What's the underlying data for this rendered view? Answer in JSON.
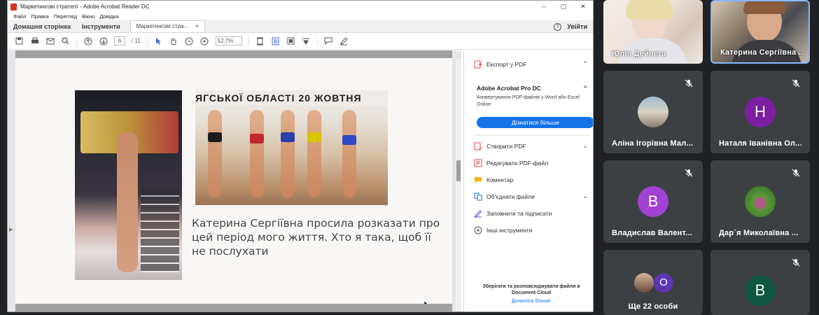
{
  "acrobat": {
    "window_title": "Маркетингові стратегії - Adobe Acrobat Reader DC",
    "window_buttons": [
      "–",
      "▢",
      "✕"
    ],
    "menu": [
      "Файл",
      "Правка",
      "Перегляд",
      "Вікно",
      "Довідка"
    ],
    "tabs": {
      "home": "Домашня сторінка",
      "tools": "Інструменти",
      "doc": "Маркетингові стра...",
      "doc_close": "×",
      "signin": "Увійти",
      "help": "?"
    },
    "toolbar": {
      "page_current": "6",
      "page_total": "/ 11",
      "zoom": "52,7%"
    },
    "document": {
      "banner_text": "ЯГСЬКОЇ ОБЛАСТІ 20 ЖОВТНЯ",
      "paragraph": "Катерина Сергіївна просила розказати про цей період мого життя. Хто я така, щоб її не послухати"
    },
    "right_panel": {
      "export_label": "Експорт у PDF",
      "promo_title": "Adobe Acrobat Pro DC",
      "promo_desc": "Конвертування PDF-файлів у Word або Excel Online",
      "promo_button": "Дізнатися більше",
      "tools": [
        {
          "label": "Створити PDF",
          "icon": "create-pdf-icon",
          "color": "#e34850"
        },
        {
          "label": "Редагувати PDF-файл",
          "icon": "edit-pdf-icon",
          "color": "#e34850"
        },
        {
          "label": "Коментар",
          "icon": "comment-icon",
          "color": "#f5b400"
        },
        {
          "label": "Об'єднати файли",
          "icon": "combine-files-icon",
          "color": "#1473e6"
        },
        {
          "label": "Заповнити та підписати",
          "icon": "fill-sign-icon",
          "color": "#7a4bd6"
        },
        {
          "label": "Інші інструменти",
          "icon": "more-tools-icon",
          "color": "#555555"
        }
      ],
      "cloud_text": "Зберігати та розповсюджувати файли в Document Cloud",
      "cloud_link": "Дізнатися більше"
    }
  },
  "meet": {
    "participants": [
      {
        "name": "Юлія Дейнега",
        "type": "video"
      },
      {
        "name": "Катерина Сергіївна ...",
        "type": "video"
      },
      {
        "name": "Аліна Ігорівна Мал...",
        "type": "photo",
        "muted": true
      },
      {
        "name": "Наталя Іванівна Ол...",
        "type": "letter",
        "letter": "Н",
        "color": "#7b1fa2",
        "muted": true
      },
      {
        "name": "Владислав Валент...",
        "type": "letter",
        "letter": "В",
        "color": "#a142d4",
        "muted": true
      },
      {
        "name": "Дар`я Миколаївна ...",
        "type": "photo",
        "muted": true
      },
      {
        "name": "Ще 22 особи",
        "type": "group",
        "letter": "О",
        "color": "#5e35b1"
      },
      {
        "name": "",
        "type": "letter",
        "letter": "В",
        "color": "#0f5540",
        "muted": true
      }
    ]
  }
}
